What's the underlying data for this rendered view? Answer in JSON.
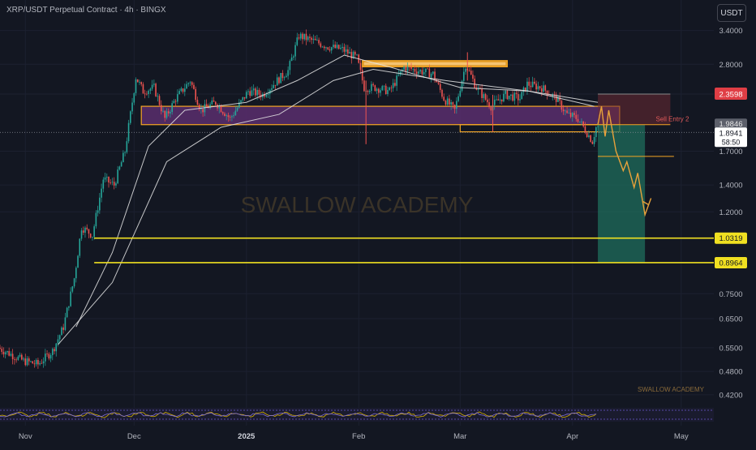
{
  "header": {
    "title": "XRP/USDT Perpetual Contract · 4h · BINGX",
    "currency_button": "USDT"
  },
  "watermark": "SWALLOW ACADEMY",
  "signature": "SWALLOW ACADEMY",
  "colors": {
    "background": "#131722",
    "up": "#26a69a",
    "down": "#ef5350",
    "ma": "#e6e6e6",
    "zone_orange": "#f5a623",
    "zone_purple": "#5b2e6d",
    "level_yellow": "#f0e021",
    "target_green": "#1f6e5c",
    "stop_red": "#6b2a33",
    "sell_entry_label": "#e05a5a"
  },
  "chart_data": {
    "type": "candlestick",
    "symbol": "XRP/USDT",
    "timeframe": "4h",
    "y_scale": "log",
    "ylim": [
      0.395,
      4.05
    ],
    "y_ticks": [
      3.4,
      2.8,
      2.36,
      1.7,
      1.4,
      1.2,
      0.75,
      0.65,
      0.55,
      0.48,
      0.42
    ],
    "y_tick_labels": [
      "3.4000",
      "2.8000",
      "2.3598",
      "1.7000",
      "1.4000",
      "1.2000",
      "0.7500",
      "0.6500",
      "0.5500",
      "0.4800",
      "0.4200"
    ],
    "x_labels": [
      "Nov",
      "Dec",
      "2025",
      "Feb",
      "Mar",
      "Apr",
      "May"
    ],
    "x_label_dates": [
      "2024-11-01",
      "2024-12-01",
      "2025-01-01",
      "2025-02-01",
      "2025-03-01",
      "2025-04-01",
      "2025-05-01"
    ],
    "price_path": [
      [
        "2024-10-25",
        0.55
      ],
      [
        "2024-11-01",
        0.51
      ],
      [
        "2024-11-05",
        0.5
      ],
      [
        "2024-11-09",
        0.54
      ],
      [
        "2024-11-12",
        0.62
      ],
      [
        "2024-11-15",
        0.82
      ],
      [
        "2024-11-17",
        1.1
      ],
      [
        "2024-11-20",
        1.05
      ],
      [
        "2024-11-23",
        1.45
      ],
      [
        "2024-11-26",
        1.4
      ],
      [
        "2024-11-29",
        1.7
      ],
      [
        "2024-12-02",
        2.6
      ],
      [
        "2024-12-04",
        2.4
      ],
      [
        "2024-12-07",
        2.45
      ],
      [
        "2024-12-10",
        2.05
      ],
      [
        "2024-12-13",
        2.3
      ],
      [
        "2024-12-17",
        2.55
      ],
      [
        "2024-12-20",
        2.15
      ],
      [
        "2024-12-24",
        2.25
      ],
      [
        "2024-12-28",
        2.05
      ],
      [
        "2025-01-02",
        2.4
      ],
      [
        "2025-01-06",
        2.35
      ],
      [
        "2025-01-10",
        2.55
      ],
      [
        "2025-01-13",
        2.7
      ],
      [
        "2025-01-16",
        3.3
      ],
      [
        "2025-01-20",
        3.2
      ],
      [
        "2025-01-24",
        3.1
      ],
      [
        "2025-01-28",
        3.05
      ],
      [
        "2025-02-01",
        2.9
      ],
      [
        "2025-02-03",
        2.45
      ],
      [
        "2025-02-06",
        2.45
      ],
      [
        "2025-02-10",
        2.4
      ],
      [
        "2025-02-14",
        2.75
      ],
      [
        "2025-02-18",
        2.7
      ],
      [
        "2025-02-22",
        2.65
      ],
      [
        "2025-02-25",
        2.3
      ],
      [
        "2025-02-28",
        2.15
      ],
      [
        "2025-03-03",
        2.8
      ],
      [
        "2025-03-06",
        2.45
      ],
      [
        "2025-03-10",
        2.2
      ],
      [
        "2025-03-14",
        2.35
      ],
      [
        "2025-03-18",
        2.3
      ],
      [
        "2025-03-20",
        2.5
      ],
      [
        "2025-03-24",
        2.45
      ],
      [
        "2025-03-28",
        2.3
      ],
      [
        "2025-03-31",
        2.1
      ],
      [
        "2025-04-03",
        2.05
      ],
      [
        "2025-04-07",
        1.8
      ],
      [
        "2025-04-08",
        1.95
      ]
    ],
    "moving_averages": [
      {
        "points": [
          [
            "2024-11-15",
            0.62
          ],
          [
            "2024-11-25",
            0.95
          ],
          [
            "2024-12-05",
            1.75
          ],
          [
            "2024-12-15",
            2.15
          ],
          [
            "2025-01-01",
            2.25
          ],
          [
            "2025-01-15",
            2.55
          ],
          [
            "2025-01-28",
            2.95
          ],
          [
            "2025-02-10",
            2.75
          ],
          [
            "2025-03-01",
            2.45
          ],
          [
            "2025-03-20",
            2.4
          ],
          [
            "2025-04-07",
            2.2
          ]
        ]
      },
      {
        "points": [
          [
            "2024-11-10",
            0.56
          ],
          [
            "2024-11-25",
            0.8
          ],
          [
            "2024-12-10",
            1.6
          ],
          [
            "2024-12-25",
            1.95
          ],
          [
            "2025-01-10",
            2.1
          ],
          [
            "2025-01-25",
            2.55
          ],
          [
            "2025-02-05",
            2.72
          ],
          [
            "2025-02-25",
            2.55
          ],
          [
            "2025-03-20",
            2.4
          ],
          [
            "2025-04-08",
            2.25
          ]
        ]
      }
    ],
    "zones": [
      {
        "start": "2025-02-02",
        "end": "2025-03-14",
        "low": 2.76,
        "high": 2.86,
        "style": "orange_filled"
      },
      {
        "start": "2024-12-03",
        "end": "2025-04-14",
        "low": 1.98,
        "high": 2.2,
        "style": "purple_orange"
      },
      {
        "start": "2025-03-01",
        "end": "2025-04-14",
        "low": 1.9,
        "high": 1.98,
        "style": "orange_outline"
      }
    ],
    "position": {
      "side": "short",
      "start": "2025-04-08",
      "end": "2025-04-21",
      "entry": 1.98,
      "stop": 2.3598,
      "target": 0.8964,
      "entry_label": "Sell Entry 2",
      "secondary_level": 1.65
    },
    "projection": [
      [
        "2025-04-08",
        1.98
      ],
      [
        "2025-04-09",
        2.2
      ],
      [
        "2025-04-10",
        1.85
      ],
      [
        "2025-04-11",
        2.15
      ],
      [
        "2025-04-13",
        1.7
      ],
      [
        "2025-04-15",
        1.52
      ],
      [
        "2025-04-16",
        1.6
      ],
      [
        "2025-04-18",
        1.38
      ],
      [
        "2025-04-19",
        1.5
      ],
      [
        "2025-04-21",
        1.18
      ],
      [
        "2025-04-22",
        1.25
      ]
    ],
    "horizontal_levels": [
      {
        "value": 1.0319,
        "label": "1.0319",
        "color": "#f0e021"
      },
      {
        "value": 0.8964,
        "label": "0.8964",
        "color": "#f0e021"
      }
    ],
    "price_tags": {
      "stop_tag": "2.3598",
      "covered_tag": "1.9846",
      "last_price": "1.8941",
      "countdown": "58:50"
    },
    "last_price_value": 1.8941
  }
}
